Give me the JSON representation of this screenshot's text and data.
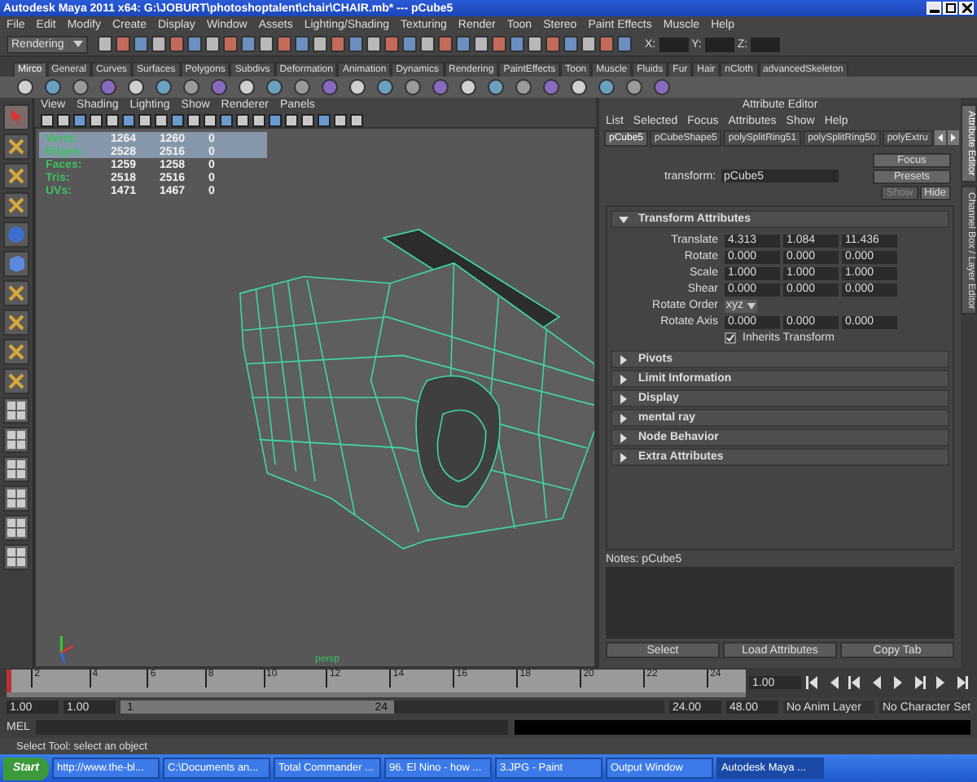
{
  "window": {
    "title": "Autodesk Maya 2011 x64: G:\\JOBURT\\photoshoptalent\\chair\\CHAIR.mb*   ---   pCube5"
  },
  "menu_bar": [
    "File",
    "Edit",
    "Modify",
    "Create",
    "Display",
    "Window",
    "Assets",
    "Lighting/Shading",
    "Texturing",
    "Render",
    "Toon",
    "Stereo",
    "Paint Effects",
    "Muscle",
    "Help"
  ],
  "status_line": {
    "menu_set": "Rendering",
    "coord_labels": [
      "X:",
      "Y:",
      "Z:"
    ]
  },
  "shelf_tabs": [
    {
      "label": "Mirco",
      "selected": true
    },
    {
      "label": "General",
      "selected": false
    },
    {
      "label": "Curves",
      "selected": false
    },
    {
      "label": "Surfaces",
      "selected": false
    },
    {
      "label": "Polygons",
      "selected": false
    },
    {
      "label": "Subdivs",
      "selected": false
    },
    {
      "label": "Deformation",
      "selected": false
    },
    {
      "label": "Animation",
      "selected": false
    },
    {
      "label": "Dynamics",
      "selected": false
    },
    {
      "label": "Rendering",
      "selected": false
    },
    {
      "label": "PaintEffects",
      "selected": false
    },
    {
      "label": "Toon",
      "selected": false
    },
    {
      "label": "Muscle",
      "selected": false
    },
    {
      "label": "Fluids",
      "selected": false
    },
    {
      "label": "Fur",
      "selected": false
    },
    {
      "label": "Hair",
      "selected": false
    },
    {
      "label": "nCloth",
      "selected": false
    },
    {
      "label": "advancedSkeleton",
      "selected": false
    }
  ],
  "viewport": {
    "menus": [
      "View",
      "Shading",
      "Lighting",
      "Show",
      "Renderer",
      "Panels"
    ],
    "hud": [
      {
        "label": "Verts:",
        "values": [
          "1264",
          "1260",
          "0"
        ],
        "highlighted": true
      },
      {
        "label": "Edges:",
        "values": [
          "2528",
          "2516",
          "0"
        ],
        "highlighted": true
      },
      {
        "label": "Faces:",
        "values": [
          "1259",
          "1258",
          "0"
        ],
        "highlighted": false
      },
      {
        "label": "Tris:",
        "values": [
          "2518",
          "2516",
          "0"
        ],
        "highlighted": false
      },
      {
        "label": "UVs:",
        "values": [
          "1471",
          "1467",
          "0"
        ],
        "highlighted": false
      }
    ],
    "camera_label": "persp"
  },
  "attribute_editor": {
    "title": "Attribute Editor",
    "menus": [
      "List",
      "Selected",
      "Focus",
      "Attributes",
      "Show",
      "Help"
    ],
    "tabs": [
      {
        "label": "pCube5",
        "selected": true
      },
      {
        "label": "pCubeShape5",
        "selected": false
      },
      {
        "label": "polySplitRing51",
        "selected": false
      },
      {
        "label": "polySplitRing50",
        "selected": false
      },
      {
        "label": "polyExtru",
        "selected": false
      }
    ],
    "node_type_label": "transform:",
    "node_name": "pCube5",
    "side_buttons": [
      {
        "label": "Focus",
        "disabled": false
      },
      {
        "label": "Presets",
        "disabled": false
      },
      {
        "label": "Show",
        "disabled": true
      },
      {
        "label": "Hide",
        "disabled": false
      }
    ],
    "sections": [
      {
        "title": "Transform Attributes",
        "expanded": true,
        "rows": [
          {
            "kind": "vector",
            "label": "Translate",
            "values": [
              "4.313",
              "1.084",
              "11.436"
            ]
          },
          {
            "kind": "vector",
            "label": "Rotate",
            "values": [
              "0.000",
              "0.000",
              "0.000"
            ]
          },
          {
            "kind": "vector",
            "label": "Scale",
            "values": [
              "1.000",
              "1.000",
              "1.000"
            ]
          },
          {
            "kind": "vector",
            "label": "Shear",
            "values": [
              "0.000",
              "0.000",
              "0.000"
            ]
          },
          {
            "kind": "dropdown",
            "label": "Rotate Order",
            "value": "xyz"
          },
          {
            "kind": "vector",
            "label": "Rotate Axis",
            "values": [
              "0.000",
              "0.000",
              "0.000"
            ]
          },
          {
            "kind": "checkbox",
            "label": "Inherits Transform",
            "checked": true
          }
        ]
      },
      {
        "title": "Pivots",
        "expanded": false
      },
      {
        "title": "Limit Information",
        "expanded": false
      },
      {
        "title": "Display",
        "expanded": false
      },
      {
        "title": "mental ray",
        "expanded": false
      },
      {
        "title": "Node Behavior",
        "expanded": false
      },
      {
        "title": "Extra Attributes",
        "expanded": false
      }
    ],
    "notes_label": "Notes:  pCube5",
    "buttons": [
      "Select",
      "Load Attributes",
      "Copy Tab"
    ]
  },
  "side_tabs": [
    {
      "label": "Attribute Editor",
      "selected": true
    },
    {
      "label": "Channel Box / Layer Editor",
      "selected": false
    }
  ],
  "time_slider": {
    "ticks": [
      "2",
      "4",
      "6",
      "8",
      "10",
      "12",
      "14",
      "16",
      "18",
      "20",
      "22",
      "24"
    ],
    "current_time": "1.00",
    "level": 0
  },
  "range_slider": {
    "start": "1.00",
    "playback_start": "1.00",
    "handle_start": "1",
    "handle_end": "24",
    "playback_end": "24.00",
    "end": "48.00",
    "anim_layer": "No Anim Layer",
    "character_set": "No Character Set"
  },
  "command_line": {
    "label": "MEL"
  },
  "help_line": "Select Tool: select an object",
  "taskbar": {
    "start": "Start",
    "items": [
      {
        "label": "http://www.the-bl...",
        "selected": false
      },
      {
        "label": "C:\\Documents an...",
        "selected": false
      },
      {
        "label": "Total Commander ...",
        "selected": false
      },
      {
        "label": "96. El Nino - how ...",
        "selected": false
      },
      {
        "label": "3.JPG - Paint",
        "selected": false
      },
      {
        "label": "Output Window",
        "selected": false
      },
      {
        "label": "Autodesk Maya ...",
        "selected": true
      }
    ]
  }
}
